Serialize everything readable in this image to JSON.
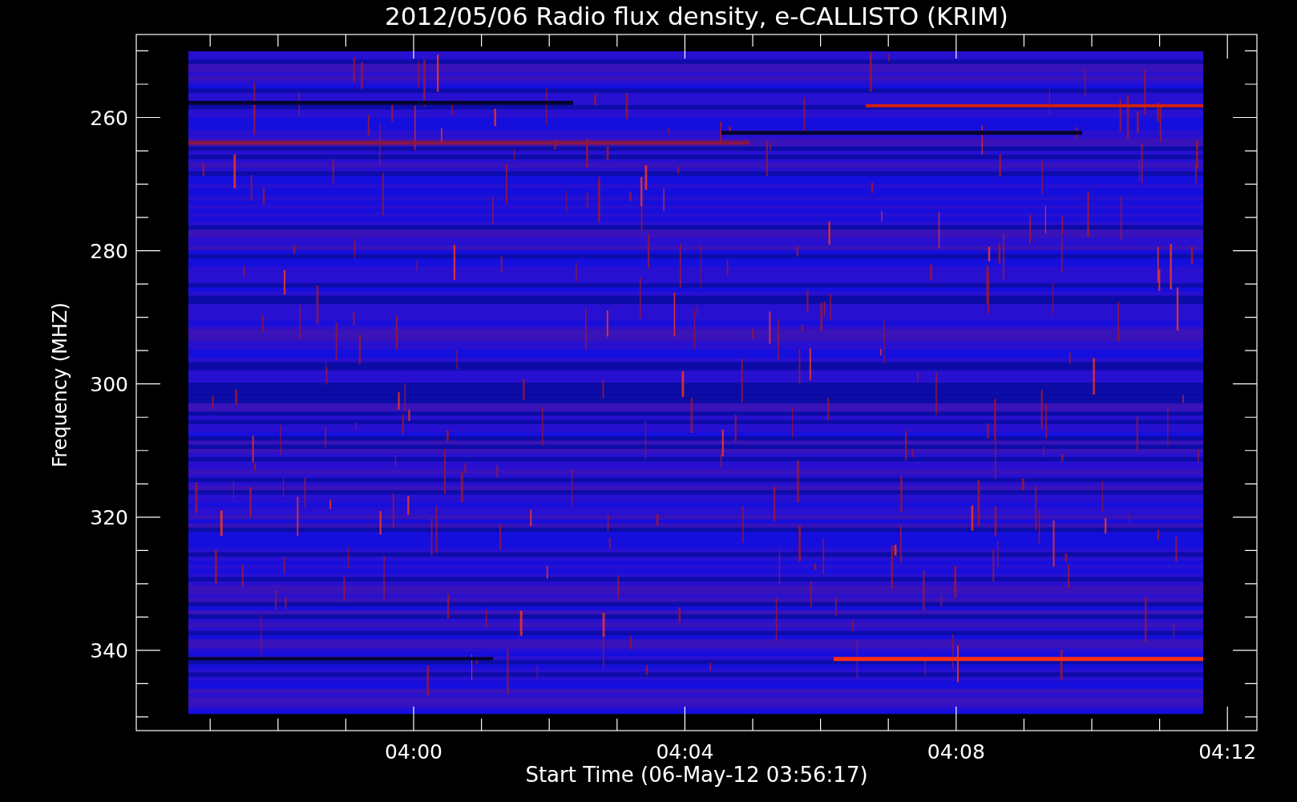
{
  "plot": {
    "title": "2012/05/06  Radio flux density, e-CALLISTO (KRIM)",
    "xlabel": "Start Time (06-May-12 03:56:17)",
    "ylabel": "Frequency (MHZ)",
    "yticks": [
      "260",
      "280",
      "300",
      "320",
      "340"
    ],
    "xticks": [
      "04:00",
      "04:04",
      "04:08",
      "04:12"
    ]
  }
}
